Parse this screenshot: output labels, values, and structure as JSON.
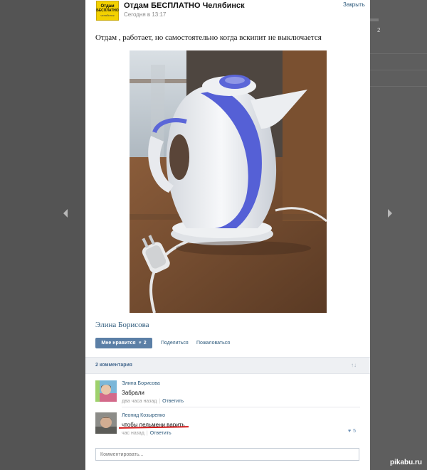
{
  "post": {
    "group_name": "Отдам БЕСПЛАТНО Челябинск",
    "time": "Сегодня в 13:17",
    "close_label": "Закрыть",
    "text": "Отдам , работает, но самостоятельно когда вскипит не выключается",
    "author": "Элина Борисова",
    "logo_lines": [
      "Отдам",
      "БЕСПЛАТНО",
      "челябинск"
    ]
  },
  "actions": {
    "like_label": "Мне нравится",
    "like_count": "2",
    "share_label": "Поделиться",
    "report_label": "Пожаловаться"
  },
  "comments_header": {
    "count_label": "2 комментария"
  },
  "comments": [
    {
      "author": "Элина Борисова",
      "text": "Забрали",
      "time": "два часа назад",
      "reply_label": "Ответить"
    },
    {
      "author": "Леонид Козыренко",
      "text": "чтобы пельмени варить",
      "time": "час назад",
      "reply_label": "Ответить",
      "likes": "5"
    }
  ],
  "compose": {
    "placeholder": "Комментировать..."
  },
  "background": {
    "peek_count": "2"
  },
  "watermark": "pikabu.ru",
  "colors": {
    "link": "#2b587a",
    "like_button": "#5b7fa6",
    "logo_yellow": "#f3d100",
    "annotation_red": "#d41a1a"
  }
}
